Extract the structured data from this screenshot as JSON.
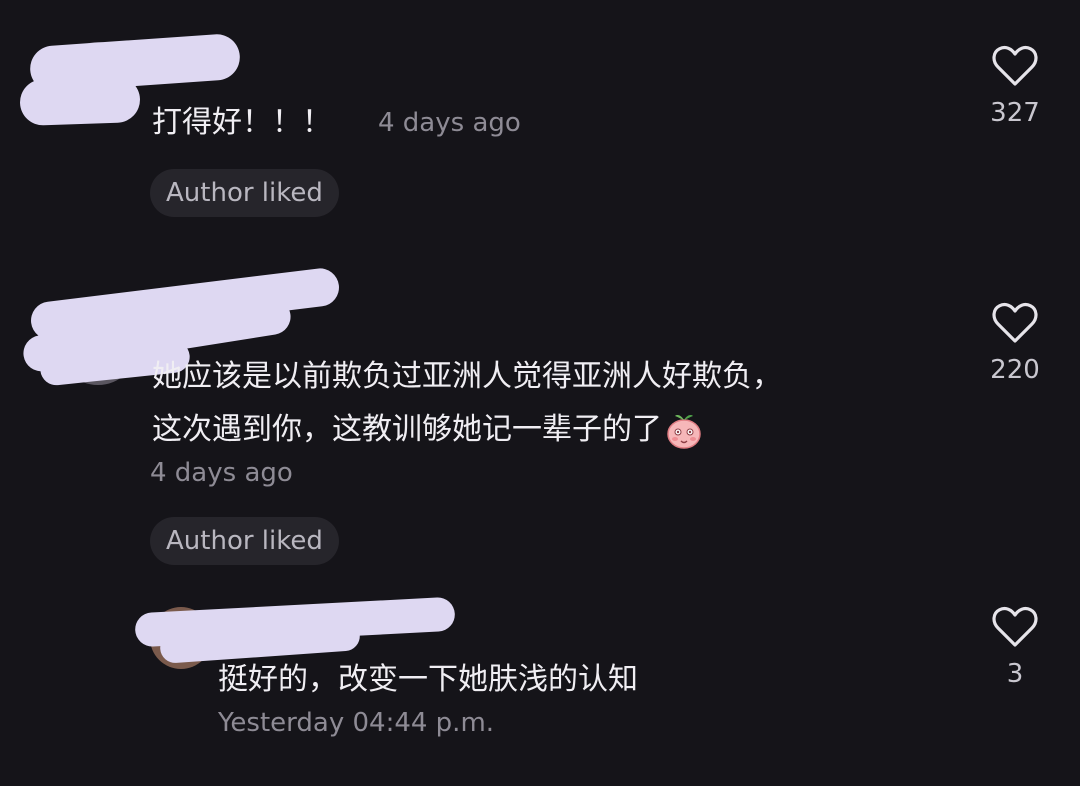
{
  "comments": [
    {
      "text": "打得好！！！",
      "time": "4 days ago",
      "author_liked": "Author liked",
      "likes": "327"
    },
    {
      "text_line1": "她应该是以前欺负过亚洲人觉得亚洲人好欺负，",
      "text_line2": "这次遇到你，这教训够她记一辈子的了",
      "emoji_icon": "blushing-peach-emoji",
      "time": "4 days ago",
      "author_liked": "Author liked",
      "likes": "220"
    },
    {
      "text": "挺好的，改变一下她肤浅的认知",
      "time": "Yesterday 04:44 p.m.",
      "likes": "3"
    }
  ],
  "colors": {
    "background": "#151419",
    "redaction": "#ded8f2",
    "chip_background": "#26252b",
    "meta_text": "#8e8b95"
  }
}
